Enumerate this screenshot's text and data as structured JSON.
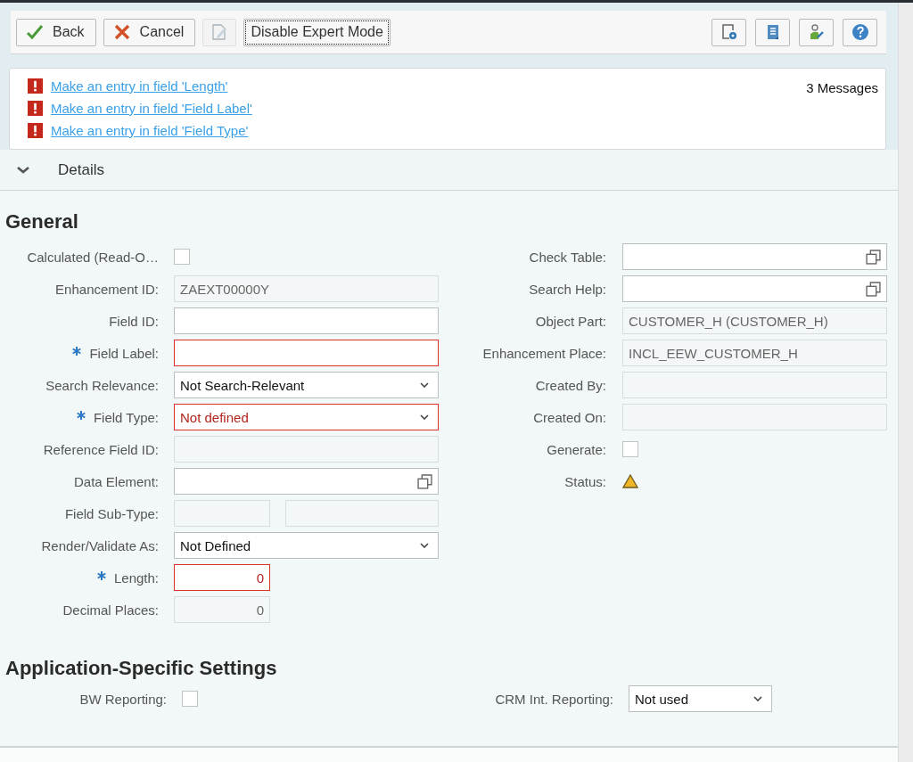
{
  "toolbar": {
    "buttons": [
      {
        "kind": "back",
        "label": "Back",
        "disabled": false,
        "focused": false
      },
      {
        "kind": "cancel",
        "label": "Cancel",
        "disabled": false,
        "focused": false
      },
      {
        "kind": "edit",
        "disabled": true,
        "focused": false
      },
      {
        "kind": "text",
        "label": "Disable Expert Mode",
        "disabled": false,
        "focused": true
      }
    ],
    "icon_buttons": [
      {
        "kind": "page-settings"
      },
      {
        "kind": "document"
      },
      {
        "kind": "user-tools"
      },
      {
        "kind": "help"
      }
    ]
  },
  "messages": {
    "count": "3 Messages",
    "items": [
      {
        "kind": "error",
        "text": "Make an entry in field 'Length'"
      },
      {
        "kind": "error",
        "text": "Make an entry in field 'Field Label'"
      },
      {
        "kind": "error",
        "text": "Make an entry in field 'Field Type'"
      }
    ]
  },
  "details": {
    "title": "Details",
    "expanded": true
  },
  "general": {
    "title": "General",
    "left": [
      {
        "kind": "checkbox",
        "label": "Calculated (Read-O…",
        "checked": false
      },
      {
        "kind": "text",
        "label": "Enhancement ID:",
        "value": "ZAEXT00000Y",
        "readonly": true
      },
      {
        "kind": "text",
        "label": "Field ID:",
        "readonly": false
      },
      {
        "kind": "text",
        "label": "Field Label:",
        "required": true,
        "error": true,
        "readonly": false
      },
      {
        "kind": "select",
        "label": "Search Relevance:",
        "value": "Not Search-Relevant"
      },
      {
        "kind": "select",
        "label": "Field Type:",
        "value": "Not defined",
        "required": true,
        "error": true
      },
      {
        "kind": "text",
        "label": "Reference Field ID:",
        "readonly": true
      },
      {
        "kind": "lookup",
        "label": "Data Element:"
      },
      {
        "kind": "pair",
        "label": "Field Sub-Type:",
        "readonly": true
      },
      {
        "kind": "select",
        "label": "Render/Validate As:",
        "value": "Not Defined"
      },
      {
        "kind": "number",
        "label": "Length:",
        "value": "0",
        "required": true,
        "error": true,
        "readonly": false
      },
      {
        "kind": "number",
        "label": "Decimal Places:",
        "value": "0",
        "readonly": true
      }
    ],
    "right": [
      {
        "kind": "lookup",
        "label": "Check Table:"
      },
      {
        "kind": "lookup",
        "label": "Search Help:"
      },
      {
        "kind": "text",
        "label": "Object Part:",
        "value": "CUSTOMER_H (CUSTOMER_H)",
        "readonly": true
      },
      {
        "kind": "text",
        "label": "Enhancement Place:",
        "value": "INCL_EEW_CUSTOMER_H",
        "readonly": true
      },
      {
        "kind": "text",
        "label": "Created By:",
        "readonly": true
      },
      {
        "kind": "text",
        "label": "Created On:",
        "readonly": true
      },
      {
        "kind": "checkbox",
        "label": "Generate:",
        "checked": false
      },
      {
        "kind": "status",
        "label": "Status:",
        "warning": true
      }
    ]
  },
  "app_settings": {
    "title": "Application-Specific Settings",
    "left": {
      "kind": "checkbox",
      "label": "BW Reporting:",
      "checked": false
    },
    "right": {
      "kind": "select",
      "label": "CRM Int. Reporting:",
      "value": "Not used"
    }
  }
}
